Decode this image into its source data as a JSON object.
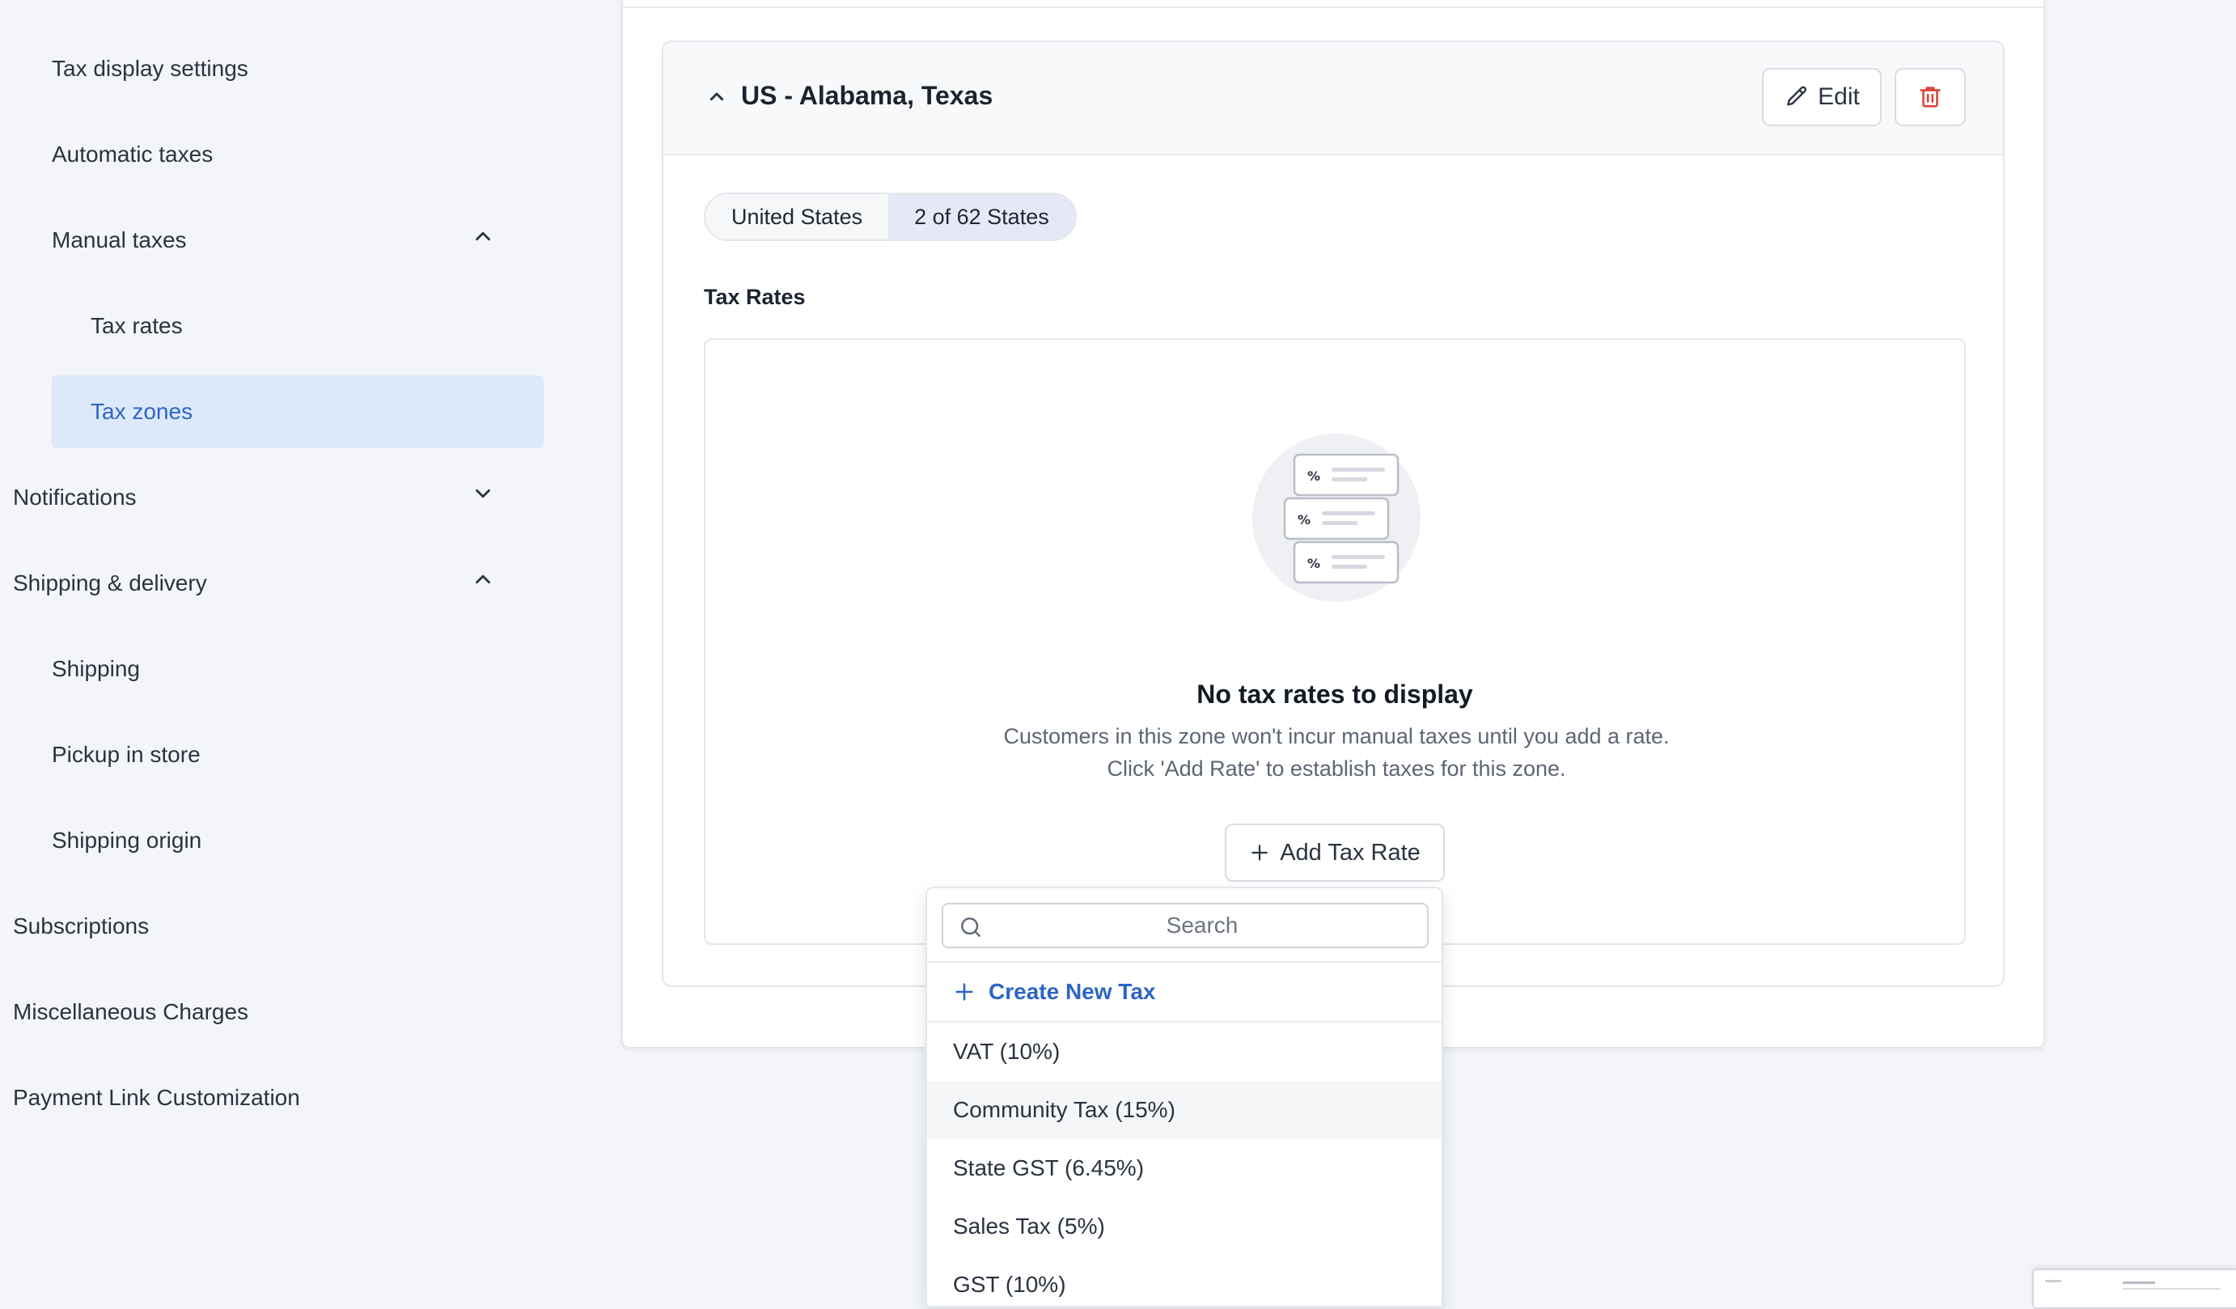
{
  "sidebar": {
    "items": [
      {
        "label": "Tax display settings"
      },
      {
        "label": "Automatic taxes"
      },
      {
        "label": "Manual taxes"
      },
      {
        "label": "Tax rates"
      },
      {
        "label": "Tax zones"
      },
      {
        "label": "Notifications"
      },
      {
        "label": "Shipping & delivery"
      },
      {
        "label": "Shipping"
      },
      {
        "label": "Pickup in store"
      },
      {
        "label": "Shipping origin"
      },
      {
        "label": "Subscriptions"
      },
      {
        "label": "Miscellaneous Charges"
      },
      {
        "label": "Payment Link Customization"
      }
    ],
    "active_item": "Tax zones"
  },
  "zone": {
    "title": "US - Alabama, Texas",
    "edit_label": "Edit",
    "country_pill": "United States",
    "states_pill": "2 of 62 States",
    "rates_heading": "Tax Rates",
    "empty_title": "No tax rates to display",
    "empty_desc": "Customers in this zone won't incur manual taxes until you add a rate. Click 'Add Rate' to establish taxes for this zone.",
    "add_label": "Add Tax Rate"
  },
  "dropdown": {
    "search_placeholder": "Search",
    "create_label": "Create New Tax",
    "options": [
      {
        "label": "VAT (10%)"
      },
      {
        "label": "Community Tax (15%)"
      },
      {
        "label": "State GST (6.45%)"
      },
      {
        "label": "Sales Tax (5%)"
      },
      {
        "label": "GST (10%)"
      }
    ],
    "hovered_option": "Community Tax (15%)"
  },
  "colors": {
    "accent": "#2c66c6",
    "active_bg": "#dde8fa",
    "danger": "#d8433b",
    "page_bg": "#f3f5f8"
  }
}
